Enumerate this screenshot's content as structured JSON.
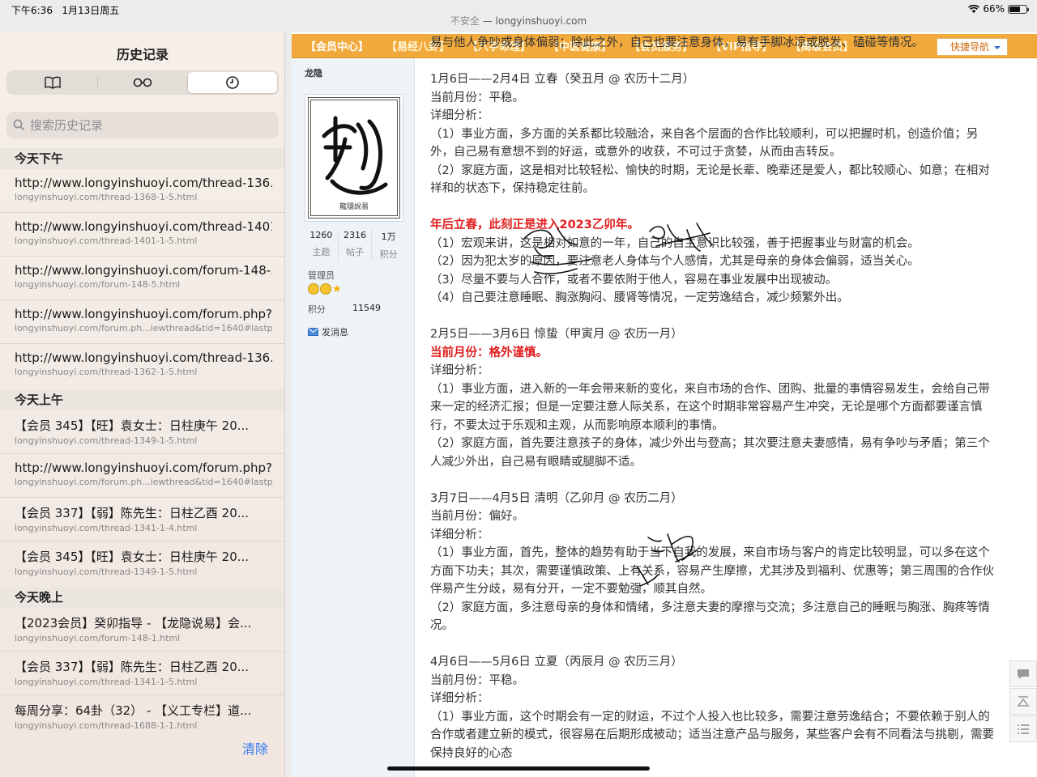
{
  "status": {
    "time": "下午6:36",
    "date": "1月13日周五",
    "battery": "66%",
    "battery_level": 0.66
  },
  "url": {
    "insecure": "不安全",
    "sep": " — ",
    "domain": "longyinshuoyi.com"
  },
  "sidebar": {
    "title": "历史记录",
    "tabs": [
      {
        "icon": "book-icon"
      },
      {
        "icon": "reading-list-icon"
      },
      {
        "icon": "clock-icon",
        "selected": true
      }
    ],
    "search_placeholder": "搜索历史记录",
    "sections": [
      {
        "label": "今天下午"
      },
      {
        "label": "今天上午"
      },
      {
        "label": "今天晚上"
      }
    ],
    "items": [
      {
        "title": "http://www.longyinshuoyi.com/thread-136...",
        "url": "longyinshuoyi.com/thread-1368-1-5.html"
      },
      {
        "title": "http://www.longyinshuoyi.com/thread-1401...",
        "url": "longyinshuoyi.com/thread-1401-1-5.html"
      },
      {
        "title": "http://www.longyinshuoyi.com/forum-148-...",
        "url": "longyinshuoyi.com/forum-148-5.html"
      },
      {
        "title": "http://www.longyinshuoyi.com/forum.php?...",
        "url": "longyinshuoyi.com/forum.ph...iewthread&tid=1640#lastpost"
      },
      {
        "title": "http://www.longyinshuoyi.com/thread-136...",
        "url": "longyinshuoyi.com/thread-1362-1-5.html"
      },
      {
        "title": "【会员 345】【旺】袁女士：日柱庚午 20...",
        "url": "longyinshuoyi.com/thread-1349-1-5.html"
      },
      {
        "title": "http://www.longyinshuoyi.com/forum.php?...",
        "url": "longyinshuoyi.com/forum.ph...iewthread&tid=1640#lastpost"
      },
      {
        "title": "【会员 337】【弱】陈先生：日柱乙酉 20...",
        "url": "longyinshuoyi.com/thread-1341-1-4.html"
      },
      {
        "title": "【会员 345】【旺】袁女士：日柱庚午 20...",
        "url": "longyinshuoyi.com/thread-1349-1-5.html"
      },
      {
        "title": "【2023会员】癸卯指导 - 【龙隐说易】会...",
        "url": "longyinshuoyi.com/forum-148-1.html"
      },
      {
        "title": "【会员 337】【弱】陈先生：日柱乙酉 20...",
        "url": "longyinshuoyi.com/thread-1341-1-5.html"
      },
      {
        "title": "每周分享：64卦（32） - 【义工专栏】道...",
        "url": "longyinshuoyi.com/thread-1688-1-1.html"
      }
    ],
    "clear": "清除"
  },
  "nav": {
    "items": [
      "【会员中心】",
      "【易经八卦】",
      "【八字命理】",
      "【中医健康】",
      "【会员服务】",
      "【VIP指导】",
      "【高级会员】"
    ],
    "quick": "快捷导航"
  },
  "user": {
    "name": "龙隐",
    "seal_text": "龍隱說易",
    "stats": [
      {
        "n": "1260",
        "l": "主题"
      },
      {
        "n": "2316",
        "l": "帖子"
      },
      {
        "n": "1万",
        "l": "积分"
      }
    ],
    "role": "管理员",
    "credits_label": "积分",
    "credits_value": "11549",
    "message": "发消息"
  },
  "post": {
    "lines": [
      {
        "text": "易与他人争吵或身体偏弱；除此之外，自己也要注意身体，易有手脚冰凉或脱发、磕碰等情况。"
      },
      {
        "gap": true
      },
      {
        "text": "1月6日——2月4日 立春（癸丑月 @ 农历十二月）"
      },
      {
        "text": "当前月份：平稳。"
      },
      {
        "text": "详细分析："
      },
      {
        "text": "（1）事业方面，多方面的关系都比较融洽，来自各个层面的合作比较顺利，可以把握时机，创造价值；另"
      },
      {
        "text": "外，自己易有意想不到的好运，或意外的收获，不可过于贪婪，从而由吉转反。"
      },
      {
        "text": "（2）家庭方面，这是相对比较轻松、愉快的时期，无论是长辈、晚辈还是爱人，都比较顺心、如意；在相对"
      },
      {
        "text": "祥和的状态下，保持稳定往前。"
      },
      {
        "gap": true
      },
      {
        "text": "年后立春，此刻正是进入2023乙卯年。",
        "red": true
      },
      {
        "text": "（1）宏观来讲，这是相对如意的一年，自己的自主意识比较强，善于把握事业与财富的机会。"
      },
      {
        "text": "（2）因为犯太岁的原因，要注意老人身体与个人感情，尤其是母亲的身体会偏弱，适当关心。"
      },
      {
        "text": "（3）尽量不要与人合作，或者不要依附于他人，容易在事业发展中出现被动。"
      },
      {
        "text": "（4）自己要注意睡眠、胸涨胸闷、腰肾等情况，一定劳逸结合，减少频繁外出。"
      },
      {
        "gap": true
      },
      {
        "text": "2月5日——3月6日 惊蛰（甲寅月 @ 农历一月）"
      },
      {
        "text": "当前月份：格外谨慎。",
        "red": true
      },
      {
        "text": "详细分析："
      },
      {
        "text": "（1）事业方面，进入新的一年会带来新的变化，来自市场的合作、团购、批量的事情容易发生，会给自己带"
      },
      {
        "text": "来一定的经济汇报；但是一定要注意人际关系，在这个时期非常容易产生冲突，无论是哪个方面都要谨言慎"
      },
      {
        "text": "行，不要太过于乐观和主观，从而影响原本顺利的事情。"
      },
      {
        "text": "（2）家庭方面，首先要注意孩子的身体，减少外出与登高；其次要注意夫妻感情，易有争吵与矛盾；第三个"
      },
      {
        "text": "人减少外出，自己易有眼睛或腿脚不适。"
      },
      {
        "gap": true
      },
      {
        "text": "3月7日——4月5日 清明（乙卯月 @ 农历二月）"
      },
      {
        "text": "当前月份：偏好。"
      },
      {
        "text": "详细分析："
      },
      {
        "text": "（1）事业方面，首先，整体的趋势有助于当下自我的发展，来自市场与客户的肯定比较明显，可以多在这个"
      },
      {
        "text": "方面下功夫；其次，需要谨慎政策、上有关系，容易产生摩擦，尤其涉及到福利、优惠等；第三周围的合作伙"
      },
      {
        "text": "伴易产生分歧，易有分开，一定不要勉强，顺其自然。"
      },
      {
        "text": "（2）家庭方面，多注意母亲的身体和情绪，多注意夫妻的摩擦与交流；多注意自己的睡眠与胸涨、胸疼等情"
      },
      {
        "text": "况。"
      },
      {
        "gap": true
      },
      {
        "text": "4月6日——5月6日 立夏（丙辰月 @ 农历三月）"
      },
      {
        "text": "当前月份：平稳。"
      },
      {
        "text": "详细分析："
      },
      {
        "text": "（1）事业方面，这个时期会有一定的财运，不过个人投入也比较多，需要注意劳逸结合；不要依赖于别人的"
      },
      {
        "text": "合作或者建立新的模式，很容易在后期形成被动；适当注意产品与服务，某些客户会有不同看法与挑剔，需要"
      },
      {
        "text": "保持良好的心态"
      }
    ]
  },
  "colors": {
    "nav_orange": "#f2a93b",
    "accent_red": "#e02020",
    "link_blue": "#3478f6"
  }
}
